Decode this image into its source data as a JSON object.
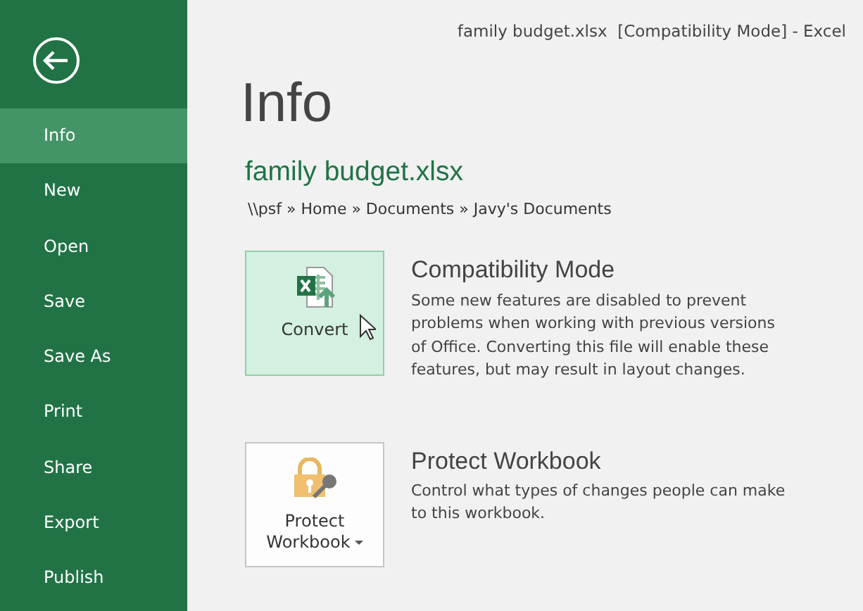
{
  "window": {
    "title": "family budget.xlsx  [Compatibility Mode] - Excel"
  },
  "sidebar": {
    "items": [
      {
        "label": "Info",
        "selected": true
      },
      {
        "label": "New",
        "selected": false
      },
      {
        "label": "Open",
        "selected": false
      },
      {
        "label": "Save",
        "selected": false
      },
      {
        "label": "Save As",
        "selected": false
      },
      {
        "label": "Print",
        "selected": false
      },
      {
        "label": "Share",
        "selected": false
      },
      {
        "label": "Export",
        "selected": false
      },
      {
        "label": "Publish",
        "selected": false
      }
    ]
  },
  "page_title": "Info",
  "file": {
    "name": "family budget.xlsx",
    "path": "\\\\psf » Home » Documents » Javy's Documents"
  },
  "sections": [
    {
      "kind": "convert",
      "button": "Convert",
      "hovered": true,
      "dropdown": false,
      "title": "Compatibility Mode",
      "description": "Some new features are disabled to prevent problems when working with previous versions of Office. Converting this file will enable these features, but may result in layout changes."
    },
    {
      "kind": "protect",
      "button": "Protect Workbook",
      "hovered": false,
      "dropdown": true,
      "title": "Protect Workbook",
      "description": "Control what types of changes people can make to this workbook."
    }
  ]
}
